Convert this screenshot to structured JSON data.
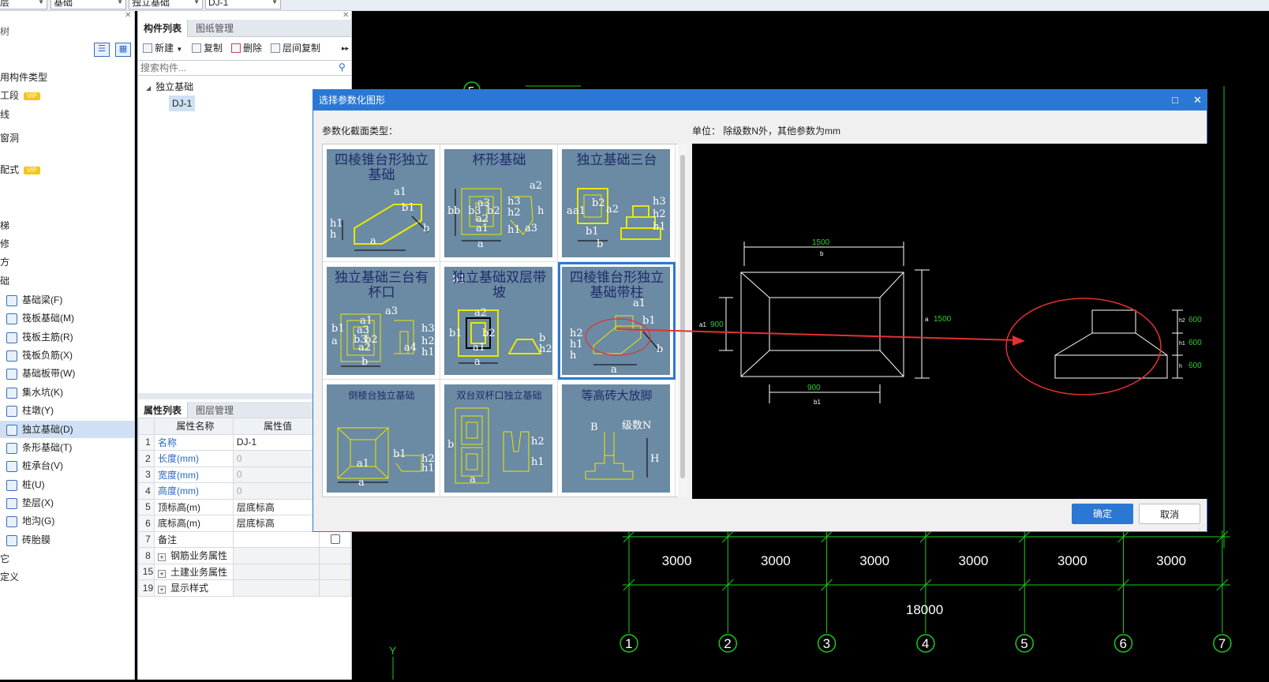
{
  "toolbar_combos": [
    "层",
    "基础",
    "独立基础",
    "DJ-1"
  ],
  "left_tree": {
    "header": "树",
    "items": [
      {
        "label": "用构件类型",
        "vip": false,
        "icon": false
      },
      {
        "label": "工段",
        "vip": true,
        "icon": false
      },
      {
        "label": "线",
        "vip": false,
        "icon": false
      },
      {
        "label": "窗洞",
        "vip": false,
        "icon": false
      },
      {
        "label": "配式",
        "vip": true,
        "icon": false
      },
      {
        "label": "梯",
        "vip": false,
        "icon": false
      },
      {
        "label": "修",
        "vip": false,
        "icon": false
      },
      {
        "label": "方",
        "vip": false,
        "icon": false
      },
      {
        "label": "础",
        "vip": false,
        "icon": false
      },
      {
        "label": "基础梁(F)",
        "icon": true
      },
      {
        "label": "筏板基础(M)",
        "icon": true
      },
      {
        "label": "筏板主筋(R)",
        "icon": true
      },
      {
        "label": "筏板负筋(X)",
        "icon": true
      },
      {
        "label": "基础板带(W)",
        "icon": true
      },
      {
        "label": "集水坑(K)",
        "icon": true
      },
      {
        "label": "柱墩(Y)",
        "icon": true
      },
      {
        "label": "独立基础(D)",
        "icon": true,
        "selected": true
      },
      {
        "label": "条形基础(T)",
        "icon": true
      },
      {
        "label": "桩承台(V)",
        "icon": true
      },
      {
        "label": "桩(U)",
        "icon": true
      },
      {
        "label": "垫层(X)",
        "icon": true
      },
      {
        "label": "地沟(G)",
        "icon": true
      },
      {
        "label": "砖胎膜",
        "icon": true
      },
      {
        "label": "它",
        "icon": false
      },
      {
        "label": "定义",
        "icon": false
      }
    ],
    "vip_label": "VIP"
  },
  "component_panel": {
    "tab_active": "构件列表",
    "tab_inactive": "图纸管理",
    "buttons": {
      "new": "新建",
      "copy": "复制",
      "delete": "删除",
      "floor_copy": "层间复制"
    },
    "search_placeholder": "搜索构件...",
    "tree_root": "独立基础",
    "tree_child": "DJ-1"
  },
  "props_panel": {
    "tab_active": "属性列表",
    "tab_inactive": "图层管理",
    "col_name": "属性名称",
    "col_value": "属性值",
    "rows": [
      {
        "n": "1",
        "name": "名称",
        "value": "DJ-1",
        "blue": true
      },
      {
        "n": "2",
        "name": "长度(mm)",
        "value": "0",
        "blue": true,
        "grey": true
      },
      {
        "n": "3",
        "name": "宽度(mm)",
        "value": "0",
        "blue": true,
        "grey": true
      },
      {
        "n": "4",
        "name": "高度(mm)",
        "value": "0",
        "blue": true,
        "grey": true
      },
      {
        "n": "5",
        "name": "顶标高(m)",
        "value": "层底标高"
      },
      {
        "n": "6",
        "name": "底标高(m)",
        "value": "层底标高"
      },
      {
        "n": "7",
        "name": "备注",
        "value": ""
      },
      {
        "n": "8",
        "name": "钢筋业务属性",
        "value": "",
        "expand": true
      },
      {
        "n": "15",
        "name": "土建业务属性",
        "value": "",
        "expand": true
      },
      {
        "n": "19",
        "name": "显示样式",
        "value": "",
        "expand": true
      }
    ]
  },
  "dialog": {
    "title": "选择参数化图形",
    "section_label": "参数化截面类型：",
    "unit_label": "单位：  除级数N外，其他参数为mm",
    "shapes": [
      {
        "title": "四棱锥台形独立基础",
        "labels": [
          "a1",
          "b1",
          "h1",
          "h",
          "a",
          "b"
        ]
      },
      {
        "title": "杯形基础",
        "labels": [
          "a2",
          "b",
          "b",
          "b3",
          "b2",
          "a3",
          "a2",
          "a1",
          "a",
          "h3",
          "h2",
          "h1",
          "h",
          "a3"
        ]
      },
      {
        "title": "独立基础三台",
        "labels": [
          "b2",
          "a2",
          "a",
          "a1",
          "b1",
          "b",
          "h3",
          "h2",
          "h1"
        ]
      },
      {
        "title": "独立基础三台有杯口",
        "labels": [
          "a3",
          "a1",
          "b1",
          "a3",
          "b2",
          "b3",
          "a2",
          "a",
          "b",
          "h3",
          "h2",
          "h1",
          "a4"
        ]
      },
      {
        "title": "独立基础双层带坡",
        "labels": [
          "a2",
          "b1",
          "b2",
          "a1",
          "a",
          "b",
          "h2",
          "h1"
        ]
      },
      {
        "title": "四棱锥台形独立基础带柱",
        "labels": [
          "a1",
          "b1",
          "h2",
          "h1",
          "h",
          "a",
          "b"
        ]
      },
      {
        "title": "倒棱台独立基础",
        "labels": [
          "b1",
          "a1",
          "a",
          "h2",
          "h1"
        ]
      },
      {
        "title": "双台双杯口独立基础",
        "labels": [
          "a",
          "b",
          "h2",
          "h1"
        ]
      },
      {
        "title": "等高砖大放脚",
        "labels": [
          "B",
          "级数N",
          "H"
        ]
      }
    ],
    "preview": {
      "top_dim_value": "1500",
      "top_dim_name": "b",
      "left_dim_value": "900",
      "left_dim_name": "a1",
      "right_dim_value": "1500",
      "right_dim_name": "a",
      "bottom_dim_value": "900",
      "bottom_dim_name": "b1",
      "h2_value": "600",
      "h1_value": "600",
      "h_value": "600",
      "h2_name": "h2",
      "h1_name": "h1",
      "h_name": "h"
    },
    "ok": "确定",
    "cancel": "取消"
  },
  "cad": {
    "top_axis_label": "5",
    "spans": [
      "3000",
      "3000",
      "3000",
      "3000",
      "3000",
      "3000"
    ],
    "total": "18000",
    "axes": [
      "1",
      "2",
      "3",
      "4",
      "5",
      "6",
      "7"
    ],
    "y_marker": "Y",
    "colors": {
      "grid": "#1ec81e",
      "dim": "#ffffff",
      "accent": "#2b78d4",
      "red": "#e53030"
    }
  }
}
